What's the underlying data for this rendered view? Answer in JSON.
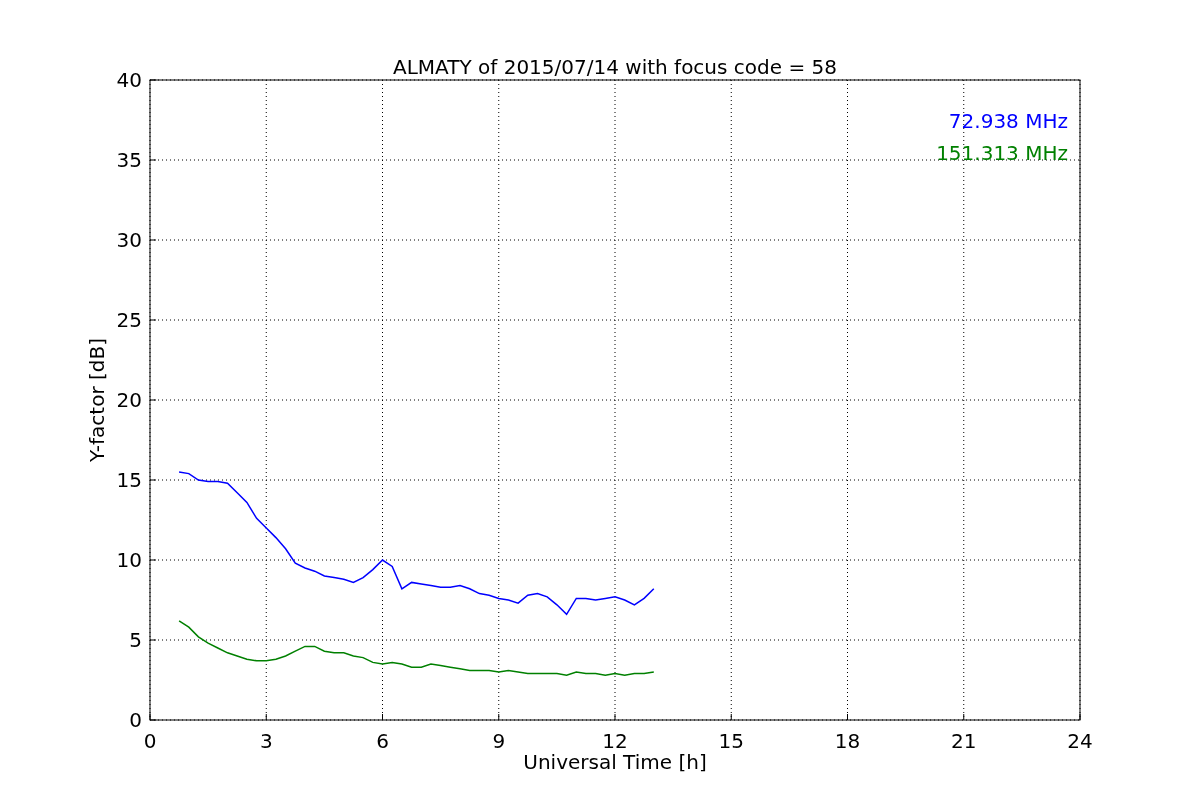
{
  "figure": {
    "chart_data": {
      "type": "line",
      "title": "ALMATY of 2015/07/14 with focus code = 58",
      "xlabel": "Universal Time [h]",
      "ylabel": "Y-factor [dB]",
      "x": [
        0.75,
        1.0,
        1.25,
        1.5,
        1.75,
        2.0,
        2.25,
        2.5,
        2.75,
        3.0,
        3.25,
        3.5,
        3.75,
        4.0,
        4.25,
        4.5,
        4.75,
        5.0,
        5.25,
        5.5,
        5.75,
        6.0,
        6.25,
        6.5,
        6.75,
        7.0,
        7.25,
        7.5,
        7.75,
        8.0,
        8.25,
        8.5,
        8.75,
        9.0,
        9.25,
        9.5,
        9.75,
        10.0,
        10.25,
        10.5,
        10.75,
        11.0,
        11.25,
        11.5,
        11.75,
        12.0,
        12.25,
        12.5,
        12.75,
        13.0
      ],
      "series": [
        {
          "name": "72.938 MHz",
          "color": "#0000ff",
          "values": [
            15.5,
            15.4,
            15.0,
            14.9,
            14.9,
            14.8,
            14.2,
            13.6,
            12.6,
            12.0,
            11.4,
            10.7,
            9.8,
            9.5,
            9.3,
            9.0,
            8.9,
            8.8,
            8.6,
            8.9,
            9.4,
            10.0,
            9.6,
            8.2,
            8.6,
            8.5,
            8.4,
            8.3,
            8.3,
            8.4,
            8.2,
            7.9,
            7.8,
            7.6,
            7.5,
            7.3,
            7.8,
            7.9,
            7.7,
            7.2,
            6.6,
            7.6,
            7.6,
            7.5,
            7.6,
            7.7,
            7.5,
            7.2,
            7.6,
            8.2
          ]
        },
        {
          "name": "151.313 MHz",
          "color": "#008000",
          "values": [
            6.2,
            5.8,
            5.2,
            4.8,
            4.5,
            4.2,
            4.0,
            3.8,
            3.7,
            3.7,
            3.8,
            4.0,
            4.3,
            4.6,
            4.6,
            4.3,
            4.2,
            4.2,
            4.0,
            3.9,
            3.6,
            3.5,
            3.6,
            3.5,
            3.3,
            3.3,
            3.5,
            3.4,
            3.3,
            3.2,
            3.1,
            3.1,
            3.1,
            3.0,
            3.1,
            3.0,
            2.9,
            2.9,
            2.9,
            2.9,
            2.8,
            3.0,
            2.9,
            2.9,
            2.8,
            2.9,
            2.8,
            2.9,
            2.9,
            3.0
          ]
        }
      ],
      "xlim": [
        0,
        24
      ],
      "ylim": [
        0,
        40
      ],
      "xticks": [
        0,
        3,
        6,
        9,
        12,
        15,
        18,
        21,
        24
      ],
      "yticks": [
        0,
        5,
        10,
        15,
        20,
        25,
        30,
        35,
        40
      ],
      "grid": true
    }
  }
}
